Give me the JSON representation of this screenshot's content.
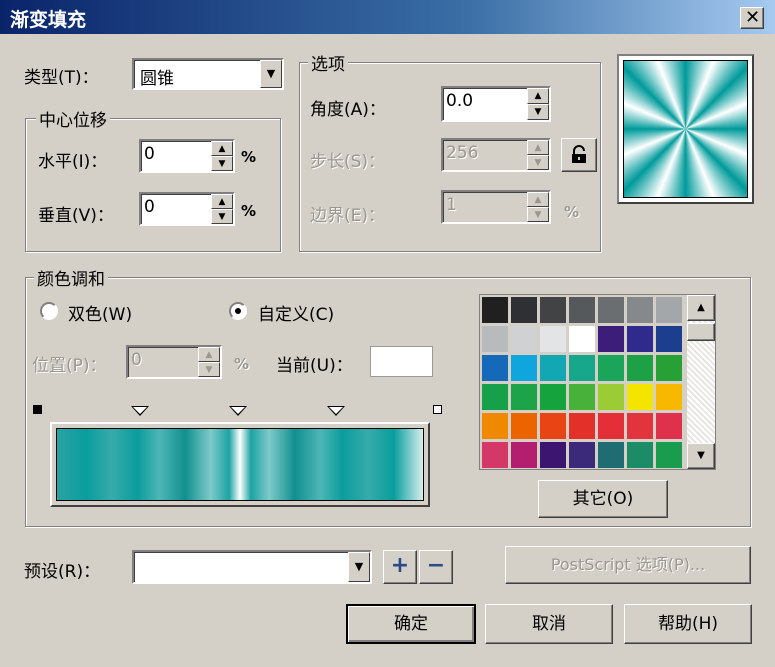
{
  "window": {
    "title": "渐变填充",
    "close_label": "✕"
  },
  "type": {
    "label": "类型(T)：",
    "value": "圆锥"
  },
  "center_offset": {
    "legend": "中心位移",
    "horizontal": {
      "label": "水平(I)：",
      "value": "0",
      "unit": "%"
    },
    "vertical": {
      "label": "垂直(V)：",
      "value": "0",
      "unit": "%"
    }
  },
  "options": {
    "legend": "选项",
    "angle": {
      "label": "角度(A)：",
      "value": "0.0"
    },
    "steps": {
      "label": "步长(S)：",
      "value": "256"
    },
    "edge": {
      "label": "边界(E)：",
      "value": "1",
      "unit": "%"
    }
  },
  "blend": {
    "legend": "颜色调和",
    "two_color_label": "双色(W)",
    "custom_label": "自定义(C)",
    "selected": "custom",
    "position": {
      "label": "位置(P)：",
      "value": "0",
      "unit": "%"
    },
    "current_label": "当前(U)：",
    "current_color": "#ffffff",
    "palette": [
      [
        "#202020",
        "#2f3033",
        "#414345",
        "#55595b",
        "#6b6e70",
        "#86898b",
        "#a4a7a9"
      ],
      [
        "#b8bbbe",
        "#cfd1d3",
        "#e3e4e6",
        "#ffffff",
        "#3c1d7a",
        "#2e2b8c",
        "#1d3d8f"
      ],
      [
        "#1469b9",
        "#10a6dd",
        "#12a7b2",
        "#17a78a",
        "#1aa55a",
        "#1ea146",
        "#27a036"
      ],
      [
        "#16a04a",
        "#1ea448",
        "#14a33c",
        "#48b139",
        "#9bcb35",
        "#f3e500",
        "#f8b800"
      ],
      [
        "#ef8a00",
        "#ec6400",
        "#e94514",
        "#e3312a",
        "#e42e38",
        "#e2343f",
        "#e0314c"
      ],
      [
        "#d33868",
        "#b31f6e",
        "#3c1571",
        "#3b2a7a",
        "#1f6d72",
        "#1d8c66",
        "#1a9c4f"
      ]
    ],
    "other_button": "其它(O)",
    "markers": [
      25,
      50,
      75
    ]
  },
  "preset": {
    "label": "预设(R)：",
    "value": "",
    "add_label": "+",
    "remove_label": "−"
  },
  "postscript_button": "PostScript 选项(P)...",
  "buttons": {
    "ok": "确定",
    "cancel": "取消",
    "help": "帮助(H)"
  },
  "gradient": {
    "preview_colors": [
      "#009a9a",
      "#ffffff"
    ],
    "strip_stops": [
      {
        "color": "#2aa3a3",
        "pos": 0
      },
      {
        "color": "#0a9d9d",
        "pos": 8
      },
      {
        "color": "#36abab",
        "pos": 15
      },
      {
        "color": "#0c9c9c",
        "pos": 22
      },
      {
        "color": "#4db6b6",
        "pos": 28
      },
      {
        "color": "#118f8f",
        "pos": 35
      },
      {
        "color": "#7fcaca",
        "pos": 42
      },
      {
        "color": "#1da3a3",
        "pos": 47
      },
      {
        "color": "#ffffff",
        "pos": 50
      },
      {
        "color": "#1da3a3",
        "pos": 53
      },
      {
        "color": "#7fcaca",
        "pos": 58
      },
      {
        "color": "#118f8f",
        "pos": 65
      },
      {
        "color": "#4db6b6",
        "pos": 72
      },
      {
        "color": "#0c9c9c",
        "pos": 78
      },
      {
        "color": "#36abab",
        "pos": 85
      },
      {
        "color": "#0a9d9d",
        "pos": 92
      },
      {
        "color": "#d8eeee",
        "pos": 100
      }
    ]
  }
}
